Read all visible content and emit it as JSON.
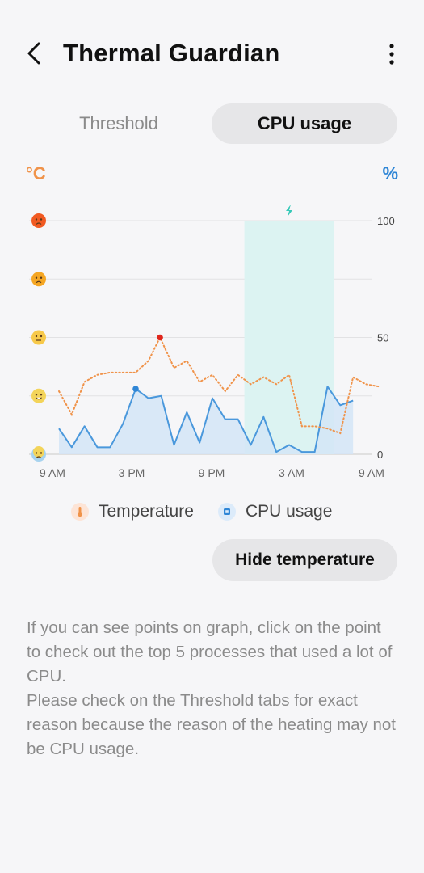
{
  "header": {
    "title": "Thermal Guardian"
  },
  "tabs": [
    {
      "label": "Threshold",
      "selected": false
    },
    {
      "label": "CPU usage",
      "selected": true
    }
  ],
  "chart_header": {
    "left_unit": "°C",
    "right_unit": "%"
  },
  "colors": {
    "temperature": "#f0934a",
    "cpu": "#4a98dc",
    "charging_band": "#dcf3f2",
    "charging_icon": "#36c9b8",
    "temp_peak_point": "#e0261c"
  },
  "chart_data": {
    "type": "line",
    "x_tick_labels": [
      "9 AM",
      "3 PM",
      "9 PM",
      "3 AM",
      "9 AM"
    ],
    "x_range_hours": [
      0,
      24
    ],
    "y_right_ticks": [
      "100",
      "50",
      "0"
    ],
    "ylim": [
      0,
      100
    ],
    "left_axis_icons": [
      "very-hot-face-icon",
      "hot-face-icon",
      "neutral-face-icon",
      "happy-face-icon",
      "cold-face-icon"
    ],
    "charging_period_hours": [
      14.5,
      21.5
    ],
    "series": [
      {
        "name": "Temperature",
        "style": "dotted",
        "points": [
          [
            0,
            27
          ],
          [
            1,
            17
          ],
          [
            2,
            31
          ],
          [
            3,
            34
          ],
          [
            4,
            35
          ],
          [
            5,
            35
          ],
          [
            6,
            35
          ],
          [
            7,
            40
          ],
          [
            7.9,
            50
          ],
          [
            9,
            37
          ],
          [
            10,
            40
          ],
          [
            11,
            31
          ],
          [
            12,
            34
          ],
          [
            13,
            27
          ],
          [
            14,
            34
          ],
          [
            15,
            30
          ],
          [
            16,
            33
          ],
          [
            17,
            30
          ],
          [
            18,
            34
          ],
          [
            19,
            12
          ],
          [
            20,
            12
          ],
          [
            21,
            11
          ],
          [
            22,
            9
          ],
          [
            23,
            33
          ],
          [
            24,
            30
          ],
          [
            25,
            29
          ]
        ],
        "highlight_point": [
          7.9,
          50
        ]
      },
      {
        "name": "CPU usage",
        "style": "area",
        "points": [
          [
            0,
            11
          ],
          [
            1,
            3
          ],
          [
            2,
            12
          ],
          [
            3,
            3
          ],
          [
            4,
            3
          ],
          [
            5,
            13
          ],
          [
            6,
            28
          ],
          [
            7,
            24
          ],
          [
            8,
            25
          ],
          [
            9,
            4
          ],
          [
            10,
            18
          ],
          [
            11,
            5
          ],
          [
            12,
            24
          ],
          [
            13,
            15
          ],
          [
            14,
            15
          ],
          [
            15,
            4
          ],
          [
            16,
            16
          ],
          [
            17,
            1
          ],
          [
            18,
            4
          ],
          [
            19,
            1
          ],
          [
            20,
            1
          ],
          [
            21,
            29
          ],
          [
            22,
            21
          ],
          [
            23,
            23
          ]
        ],
        "highlight_point": [
          6,
          28
        ]
      }
    ]
  },
  "legend": {
    "temperature_label": "Temperature",
    "cpu_label": "CPU usage"
  },
  "hide_temperature_button": "Hide temperature",
  "info": {
    "line1": "If you can see points on graph, click on the point to check out the top 5 processes that used a lot of CPU.",
    "line2": "Please check on the Threshold tabs for exact reason because the reason of the heating may not be CPU usage."
  }
}
